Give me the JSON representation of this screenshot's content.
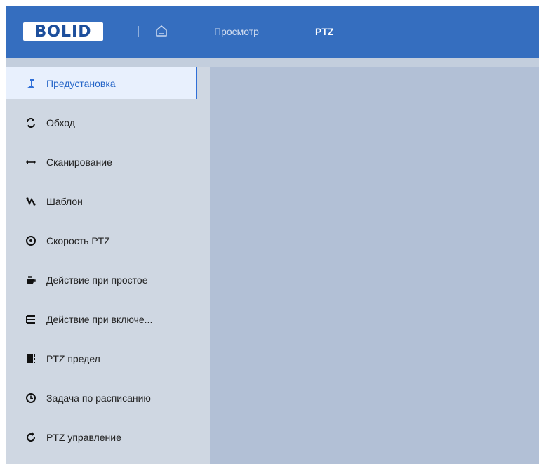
{
  "header": {
    "logo_text": "BOLID",
    "nav": [
      "Просмотр",
      "PTZ"
    ],
    "active_nav": "PTZ"
  },
  "sidebar": {
    "items": [
      {
        "label": "Предустановка",
        "icon": "preset-pin-icon",
        "active": true
      },
      {
        "label": "Обход",
        "icon": "tour-cycle-icon",
        "active": false
      },
      {
        "label": "Сканирование",
        "icon": "scan-arrows-icon",
        "active": false
      },
      {
        "label": "Шаблон",
        "icon": "pattern-icon",
        "active": false
      },
      {
        "label": "Скорость PTZ",
        "icon": "speed-dial-icon",
        "active": false
      },
      {
        "label": "Действие при простое",
        "icon": "idle-cup-icon",
        "active": false
      },
      {
        "label": "Действие при включе...",
        "icon": "power-up-lines-icon",
        "active": false
      },
      {
        "label": "PTZ предел",
        "icon": "limit-icon",
        "active": false
      },
      {
        "label": "Задача по расписанию",
        "icon": "schedule-clock-icon",
        "active": false
      },
      {
        "label": "PTZ управление",
        "icon": "refresh-control-icon",
        "active": false
      }
    ]
  },
  "colors": {
    "header": "#356ebf",
    "sidebar": "#cfd7e2",
    "active_item": "#e8f0fd",
    "accent": "#2f6fd8",
    "content": "#b2c0d6"
  }
}
